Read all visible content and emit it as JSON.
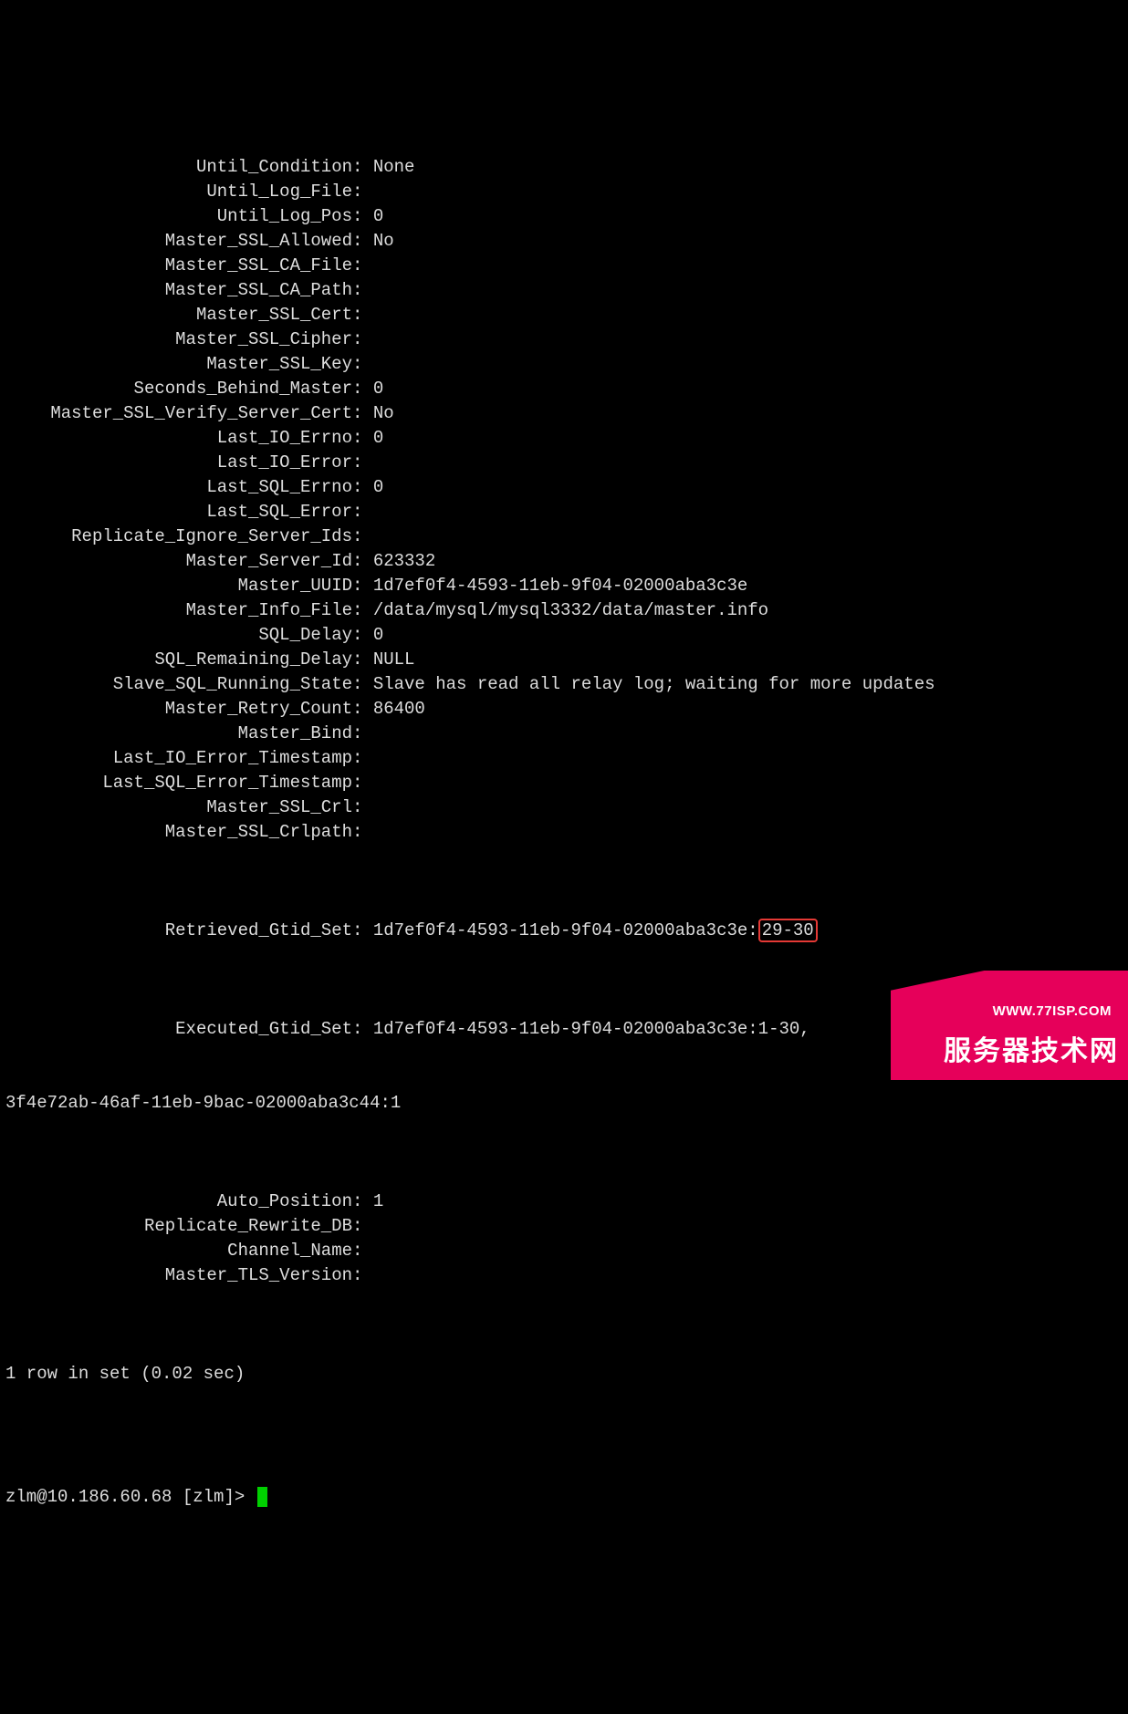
{
  "status": {
    "rows": [
      {
        "label": "Until_Condition",
        "value": "None"
      },
      {
        "label": "Until_Log_File",
        "value": ""
      },
      {
        "label": "Until_Log_Pos",
        "value": "0"
      },
      {
        "label": "Master_SSL_Allowed",
        "value": "No"
      },
      {
        "label": "Master_SSL_CA_File",
        "value": ""
      },
      {
        "label": "Master_SSL_CA_Path",
        "value": ""
      },
      {
        "label": "Master_SSL_Cert",
        "value": ""
      },
      {
        "label": "Master_SSL_Cipher",
        "value": ""
      },
      {
        "label": "Master_SSL_Key",
        "value": ""
      },
      {
        "label": "Seconds_Behind_Master",
        "value": "0"
      },
      {
        "label": "Master_SSL_Verify_Server_Cert",
        "value": "No"
      },
      {
        "label": "Last_IO_Errno",
        "value": "0"
      },
      {
        "label": "Last_IO_Error",
        "value": ""
      },
      {
        "label": "Last_SQL_Errno",
        "value": "0"
      },
      {
        "label": "Last_SQL_Error",
        "value": ""
      },
      {
        "label": "Replicate_Ignore_Server_Ids",
        "value": ""
      },
      {
        "label": "Master_Server_Id",
        "value": "623332"
      },
      {
        "label": "Master_UUID",
        "value": "1d7ef0f4-4593-11eb-9f04-02000aba3c3e"
      },
      {
        "label": "Master_Info_File",
        "value": "/data/mysql/mysql3332/data/master.info"
      },
      {
        "label": "SQL_Delay",
        "value": "0"
      },
      {
        "label": "SQL_Remaining_Delay",
        "value": "NULL"
      },
      {
        "label": "Slave_SQL_Running_State",
        "value": "Slave has read all relay log; waiting for more updates"
      },
      {
        "label": "Master_Retry_Count",
        "value": "86400"
      },
      {
        "label": "Master_Bind",
        "value": ""
      },
      {
        "label": "Last_IO_Error_Timestamp",
        "value": ""
      },
      {
        "label": "Last_SQL_Error_Timestamp",
        "value": ""
      },
      {
        "label": "Master_SSL_Crl",
        "value": ""
      },
      {
        "label": "Master_SSL_Crlpath",
        "value": ""
      }
    ],
    "retrieved_gtid": {
      "label": "Retrieved_Gtid_Set",
      "value_prefix": "1d7ef0f4-4593-11eb-9f04-02000aba3c3e:",
      "highlighted": "29-30"
    },
    "executed_gtid": {
      "label": "Executed_Gtid_Set",
      "value_line1": "1d7ef0f4-4593-11eb-9f04-02000aba3c3e:1-30,",
      "value_line2": "3f4e72ab-46af-11eb-9bac-02000aba3c44:1"
    },
    "rows_after": [
      {
        "label": "Auto_Position",
        "value": "1"
      },
      {
        "label": "Replicate_Rewrite_DB",
        "value": ""
      },
      {
        "label": "Channel_Name",
        "value": ""
      },
      {
        "label": "Master_TLS_Version",
        "value": ""
      }
    ],
    "footer": "1 row in set (0.02 sec)"
  },
  "prompt": "zlm@10.186.60.68 [zlm]> ",
  "watermark": {
    "url": "WWW.77ISP.COM",
    "cn": "服务器技术网"
  }
}
